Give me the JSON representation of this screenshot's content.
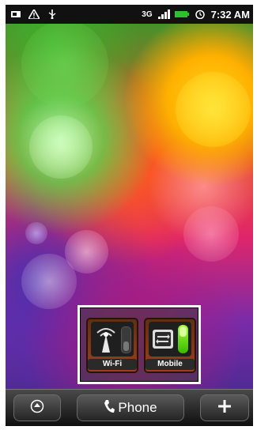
{
  "status_bar": {
    "network_type": "3G",
    "time": "7:32 AM",
    "icons": [
      "screenshot-icon",
      "warning-icon",
      "usb-icon",
      "signal-icon",
      "battery-icon",
      "alarm-icon"
    ]
  },
  "widget": {
    "wifi_label": "Wi-Fi",
    "mobile_label": "Mobile"
  },
  "dock": {
    "phone_label": "Phone",
    "icons": [
      "apps-icon",
      "phone-icon",
      "add-icon"
    ]
  }
}
